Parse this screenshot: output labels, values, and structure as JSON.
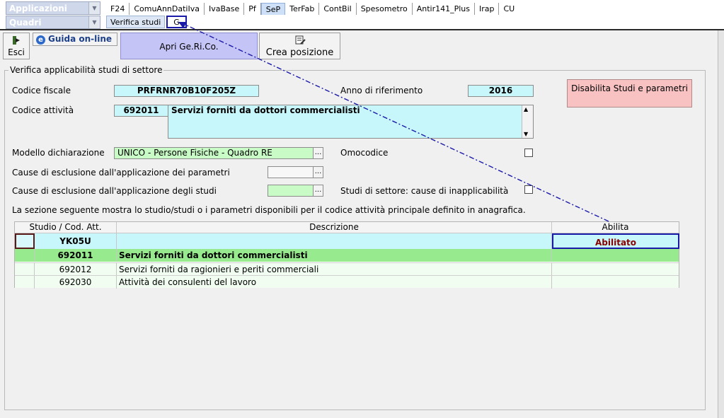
{
  "top": {
    "applicazioni_label": "Applicazioni",
    "quadri_label": "Quadri",
    "tabs": [
      "F24",
      "ComuAnnDatiIva",
      "IvaBase",
      "Pf",
      "SeP",
      "TerFab",
      "ContBil",
      "Spesometro",
      "Antir141_Plus",
      "Irap",
      "CU"
    ],
    "active_tab": "SeP",
    "subtabs": [
      "Verifica studi",
      "G"
    ]
  },
  "toolbar": {
    "esci": "Esci",
    "guida": "Guida on-line",
    "apri": "Apri Ge.Ri.Co.",
    "crea": "Crea posizione"
  },
  "form": {
    "legend": "Verifica applicabilità studi di settore",
    "codice_fiscale_label": "Codice fiscale",
    "codice_fiscale_value": "PRFRNR70B10F205Z",
    "anno_label": "Anno di riferimento",
    "anno_value": "2016",
    "disabilita_button": "Disabilita Studi e parametri",
    "codice_attivita_label": "Codice attività",
    "codice_attivita_code": "692011",
    "codice_attivita_desc": "Servizi forniti da dottori commercialisti",
    "modello_label": "Modello dichiarazione",
    "modello_value": "UNICO - Persone Fisiche - Quadro RE",
    "omocodice_label": "Omocodice",
    "cause_parametri_label": "Cause di esclusione dall'applicazione dei parametri",
    "cause_studi_label": "Cause di esclusione dall'applicazione degli studi",
    "inapplicabilita_label": "Studi di settore: cause di inapplicabilità",
    "info_text": "La sezione seguente mostra lo studio/studi o i parametri disponibili per il codice attività principale definito in anagrafica."
  },
  "table": {
    "headers": [
      "Studio / Cod. Att.",
      "Descrizione",
      "Abilita"
    ],
    "studio_row": {
      "code": "YK05U",
      "desc": "",
      "abilita": "Abilitato"
    },
    "rows": [
      {
        "code": "692011",
        "desc": "Servizi forniti da dottori commercialisti",
        "bold": true
      },
      {
        "code": "692012",
        "desc": "Servizi forniti da ragionieri e periti commerciali",
        "bold": false
      },
      {
        "code": "692030",
        "desc": "Attività dei consulenti del lavoro",
        "bold": false
      }
    ]
  },
  "colors": {
    "highlight_border": "#1a1aa8",
    "abilitato_text": "#8b0000",
    "row_green": "#97ea8d",
    "row_light": "#f0fdf0",
    "cyan": "#c7f7fb",
    "pink_button": "#f8c2c2",
    "violet_button": "#c4c4f6"
  }
}
